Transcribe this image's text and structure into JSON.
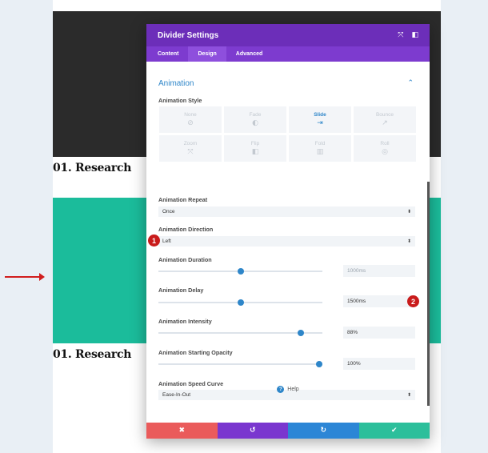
{
  "background": {
    "headings": [
      "01. Research",
      "01. Research"
    ],
    "colors": {
      "dark": "#2b2b2b",
      "teal": "#1bbc9b",
      "arrow": "#d11d1d"
    }
  },
  "modal": {
    "title": "Divider Settings",
    "header_icons": [
      "expand-icon",
      "sidebar-icon"
    ],
    "tabs": [
      {
        "label": "Content",
        "active": false
      },
      {
        "label": "Design",
        "active": true
      },
      {
        "label": "Advanced",
        "active": false
      }
    ],
    "section": {
      "title": "Animation",
      "collapse_icon": "chevron-up-icon"
    },
    "animation_style": {
      "label": "Animation Style",
      "options": [
        {
          "name": "None",
          "icon": "none-icon",
          "glyph": "⊘",
          "active": false
        },
        {
          "name": "Fade",
          "icon": "fade-icon",
          "glyph": "◐",
          "active": false
        },
        {
          "name": "Slide",
          "icon": "slide-icon",
          "glyph": "⇥",
          "active": true
        },
        {
          "name": "Bounce",
          "icon": "bounce-icon",
          "glyph": "↗",
          "active": false
        },
        {
          "name": "Zoom",
          "icon": "zoom-icon",
          "glyph": "⤧",
          "active": false
        },
        {
          "name": "Flip",
          "icon": "flip-icon",
          "glyph": "◧",
          "active": false
        },
        {
          "name": "Fold",
          "icon": "fold-icon",
          "glyph": "▥",
          "active": false
        },
        {
          "name": "Roll",
          "icon": "roll-icon",
          "glyph": "◎",
          "active": false
        }
      ]
    },
    "animation_repeat": {
      "label": "Animation Repeat",
      "value": "Once"
    },
    "animation_direction": {
      "label": "Animation Direction",
      "value": "Left"
    },
    "animation_duration": {
      "label": "Animation Duration",
      "value": "1000ms",
      "slider_fraction": 0.5
    },
    "animation_delay": {
      "label": "Animation Delay",
      "value": "1500ms",
      "slider_fraction": 0.5
    },
    "animation_intensity": {
      "label": "Animation Intensity",
      "value": "88%",
      "slider_fraction": 0.87
    },
    "animation_opacity": {
      "label": "Animation Starting Opacity",
      "value": "100%",
      "slider_fraction": 0.98
    },
    "animation_speed_curve": {
      "label": "Animation Speed Curve",
      "value": "Ease-In-Out"
    },
    "help": {
      "label": "Help",
      "icon": "question-icon"
    },
    "footer_buttons": [
      {
        "name": "cancel",
        "icon": "close-icon",
        "glyph": "✖",
        "color": "#ea5b5b"
      },
      {
        "name": "undo",
        "icon": "undo-icon",
        "glyph": "↺",
        "color": "#7a36cf"
      },
      {
        "name": "redo",
        "icon": "redo-icon",
        "glyph": "↻",
        "color": "#2c86d6"
      },
      {
        "name": "save",
        "icon": "check-icon",
        "glyph": "✔",
        "color": "#2cbf9b"
      }
    ],
    "badges": [
      "1",
      "2"
    ],
    "accent_color": "#2e86c9",
    "header_color": "#6c2eb9"
  }
}
